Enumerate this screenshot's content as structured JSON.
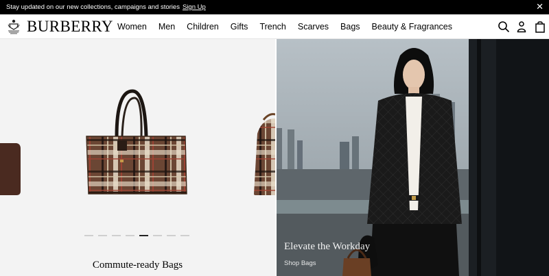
{
  "announcement": {
    "text": "Stay updated on our new collections, campaigns and stories",
    "link": "Sign Up",
    "close": "✕"
  },
  "brand": {
    "logo": "BURBERRY"
  },
  "nav": {
    "items": [
      "Women",
      "Men",
      "Children",
      "Gifts",
      "Trench",
      "Scarves",
      "Bags",
      "Beauty & Fragrances"
    ]
  },
  "header_icons": [
    "search-icon",
    "account-icon",
    "bag-icon"
  ],
  "carousel": {
    "caption": "Commute-ready Bags",
    "slide_count": 8,
    "active_index": 4
  },
  "promo": {
    "title": "Elevate the Workday",
    "link": "Shop Bags"
  },
  "colors": {
    "announcement_bg": "#000000",
    "check_brown": "#6b4634",
    "panel_bg": "#f3f3f3"
  }
}
